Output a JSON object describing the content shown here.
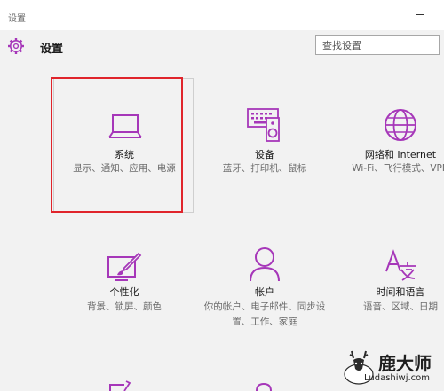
{
  "window": {
    "title": "设置"
  },
  "header": {
    "title": "设置",
    "search_placeholder": "查找设置"
  },
  "tiles": [
    {
      "name": "系统",
      "desc": "显示、通知、应用、电源",
      "icon": "laptop-icon"
    },
    {
      "name": "设备",
      "desc": "蓝牙、打印机、鼠标",
      "icon": "keyboard-speaker-icon"
    },
    {
      "name": "网络和 Internet",
      "desc": "Wi-Fi、飞行模式、VPN",
      "icon": "globe-icon"
    },
    {
      "name": "个性化",
      "desc": "背景、锁屏、颜色",
      "icon": "paintbrush-icon"
    },
    {
      "name": "帐户",
      "desc": "你的帐户、电子邮件、同步设置、工作、家庭",
      "icon": "person-icon"
    },
    {
      "name": "时间和语言",
      "desc": "语音、区域、日期",
      "icon": "time-language-icon"
    }
  ],
  "watermark": {
    "brand": "鹿大师",
    "url": "Ludashiwj.com"
  },
  "colors": {
    "accent": "#a637b9",
    "highlight": "#e0242b"
  }
}
